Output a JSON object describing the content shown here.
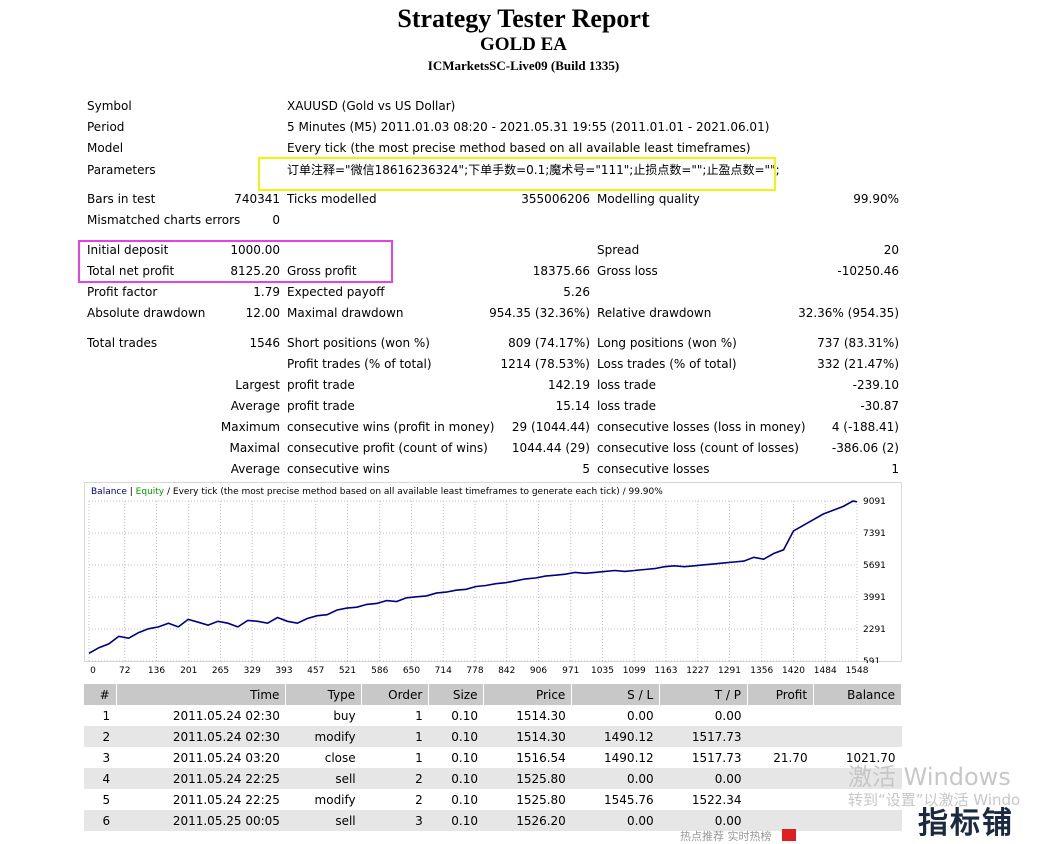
{
  "header": {
    "title": "Strategy Tester Report",
    "subtitle": "GOLD EA",
    "server": "ICMarketsSC-Live09 (Build 1335)"
  },
  "info": {
    "symbol_label": "Symbol",
    "symbol_value": "XAUUSD (Gold vs US Dollar)",
    "period_label": "Period",
    "period_value": "5 Minutes (M5) 2011.01.03 08:20 - 2021.05.31 19:55 (2011.01.01 - 2021.06.01)",
    "model_label": "Model",
    "model_value": "Every tick (the most precise method based on all available least timeframes)",
    "params_label": "Parameters",
    "params_value": "订单注释=\"微信18616236324\";下单手数=0.1;魔术号=\"111\";止损点数=\"\";止盈点数=\"\";",
    "bars_label": "Bars in test",
    "bars_value": "740341",
    "ticks_label": "Ticks modelled",
    "ticks_value": "355006206",
    "quality_label": "Modelling quality",
    "quality_value": "99.90%",
    "mismatch_label": "Mismatched charts errors",
    "mismatch_value": "0",
    "deposit_label": "Initial deposit",
    "deposit_value": "1000.00",
    "spread_label": "Spread",
    "spread_value": "20",
    "netprofit_label": "Total net profit",
    "netprofit_value": "8125.20",
    "grossprofit_label": "Gross profit",
    "grossprofit_value": "18375.66",
    "grossloss_label": "Gross loss",
    "grossloss_value": "-10250.46",
    "pf_label": "Profit factor",
    "pf_value": "1.79",
    "ep_label": "Expected payoff",
    "ep_value": "5.26",
    "absdd_label": "Absolute drawdown",
    "absdd_value": "12.00",
    "maxdd_label": "Maximal drawdown",
    "maxdd_value": "954.35 (32.36%)",
    "reldd_label": "Relative drawdown",
    "reldd_value": "32.36% (954.35)",
    "trades_label": "Total trades",
    "trades_value": "1546",
    "short_label": "Short positions (won %)",
    "short_value": "809 (74.17%)",
    "long_label": "Long positions (won %)",
    "long_value": "737 (83.31%)",
    "pt_label": "Profit trades (% of total)",
    "pt_value": "1214 (78.53%)",
    "lt_label": "Loss trades (% of total)",
    "lt_value": "332 (21.47%)",
    "largest_label": "Largest",
    "largest_pt_label": "profit trade",
    "largest_pt_value": "142.19",
    "largest_lt_label": "loss trade",
    "largest_lt_value": "-239.10",
    "average_label": "Average",
    "average_pt_label": "profit trade",
    "average_pt_value": "15.14",
    "average_lt_label": "loss trade",
    "average_lt_value": "-30.87",
    "maximum_label": "Maximum",
    "max_cw_label": "consecutive wins (profit in money)",
    "max_cw_value": "29 (1044.44)",
    "max_cl_label": "consecutive losses (loss in money)",
    "max_cl_value": "4 (-188.41)",
    "maximal_label": "Maximal",
    "mx_cp_label": "consecutive profit (count of wins)",
    "mx_cp_value": "1044.44 (29)",
    "mx_cl_label": "consecutive loss (count of losses)",
    "mx_cl_value": "-386.06 (2)",
    "avg2_label": "Average",
    "avg_cw_label": "consecutive wins",
    "avg_cw_value": "5",
    "avg_cl_label": "consecutive losses",
    "avg_cl_value": "1"
  },
  "chart_data": {
    "type": "line",
    "legend_balance": "Balance",
    "legend_equity": "Equity",
    "title_rest": " / Every tick (the most precise method based on all available least timeframes to generate each tick) / 99.90%",
    "x_ticks": [
      "0",
      "72",
      "136",
      "201",
      "265",
      "329",
      "393",
      "457",
      "521",
      "586",
      "650",
      "714",
      "778",
      "842",
      "906",
      "971",
      "1035",
      "1099",
      "1163",
      "1227",
      "1291",
      "1356",
      "1420",
      "1484",
      "1548"
    ],
    "y_ticks": [
      "9091",
      "7391",
      "5691",
      "3991",
      "2291",
      "591"
    ],
    "ylim": [
      591,
      9091
    ],
    "xlim": [
      0,
      1548
    ],
    "line_color": "#000080",
    "series": [
      {
        "name": "Balance",
        "x": [
          0,
          20,
          40,
          60,
          80,
          100,
          120,
          140,
          160,
          180,
          200,
          220,
          240,
          260,
          280,
          300,
          320,
          340,
          360,
          380,
          400,
          420,
          440,
          460,
          480,
          500,
          520,
          540,
          560,
          580,
          600,
          620,
          640,
          660,
          680,
          700,
          720,
          740,
          760,
          780,
          800,
          820,
          840,
          860,
          880,
          900,
          920,
          940,
          960,
          980,
          1000,
          1020,
          1040,
          1060,
          1080,
          1100,
          1120,
          1140,
          1160,
          1180,
          1200,
          1220,
          1240,
          1260,
          1280,
          1300,
          1320,
          1340,
          1360,
          1380,
          1400,
          1420,
          1440,
          1460,
          1480,
          1500,
          1520,
          1540,
          1548
        ],
        "values": [
          1000,
          1300,
          1500,
          1900,
          1800,
          2100,
          2300,
          2400,
          2600,
          2400,
          2800,
          2650,
          2500,
          2700,
          2600,
          2400,
          2750,
          2700,
          2600,
          2900,
          2700,
          2600,
          2850,
          3000,
          3050,
          3300,
          3400,
          3450,
          3600,
          3650,
          3800,
          3750,
          3950,
          4000,
          4050,
          4200,
          4250,
          4350,
          4400,
          4550,
          4600,
          4700,
          4750,
          4850,
          4950,
          5000,
          5100,
          5150,
          5200,
          5300,
          5250,
          5300,
          5350,
          5400,
          5350,
          5400,
          5450,
          5500,
          5600,
          5650,
          5600,
          5650,
          5700,
          5750,
          5800,
          5850,
          5900,
          6100,
          6000,
          6300,
          6500,
          7500,
          7800,
          8100,
          8400,
          8600,
          8800,
          9091,
          9050
        ]
      }
    ]
  },
  "deals": {
    "columns": [
      "#",
      "Time",
      "Type",
      "Order",
      "Size",
      "Price",
      "S / L",
      "T / P",
      "Profit",
      "Balance"
    ],
    "rows": [
      [
        "1",
        "2011.05.24 02:30",
        "buy",
        "1",
        "0.10",
        "1514.30",
        "0.00",
        "0.00",
        "",
        ""
      ],
      [
        "2",
        "2011.05.24 02:30",
        "modify",
        "1",
        "0.10",
        "1514.30",
        "1490.12",
        "1517.73",
        "",
        ""
      ],
      [
        "3",
        "2011.05.24 03:20",
        "close",
        "1",
        "0.10",
        "1516.54",
        "1490.12",
        "1517.73",
        "21.70",
        "1021.70"
      ],
      [
        "4",
        "2011.05.24 22:25",
        "sell",
        "2",
        "0.10",
        "1525.80",
        "0.00",
        "0.00",
        "",
        ""
      ],
      [
        "5",
        "2011.05.24 22:25",
        "modify",
        "2",
        "0.10",
        "1525.80",
        "1545.76",
        "1522.34",
        "",
        ""
      ],
      [
        "6",
        "2011.05.25 00:05",
        "sell",
        "3",
        "0.10",
        "1526.20",
        "0.00",
        "0.00",
        "",
        ""
      ]
    ]
  },
  "overlay": {
    "win_activate": "激活 Windows",
    "win_goto": "转到“设置”以激活 Windo",
    "stamp": "指标铺",
    "bottom_text": "热点推荐     实时热榜"
  }
}
